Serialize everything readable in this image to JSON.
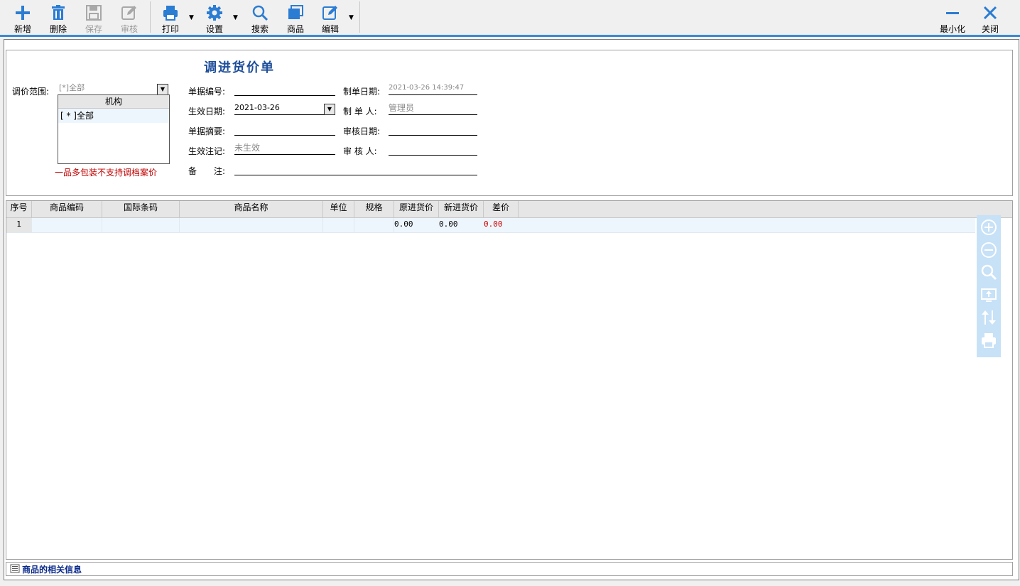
{
  "toolbar": {
    "buttons": [
      {
        "label": "新增",
        "icon": "plus-icon",
        "enabled": true
      },
      {
        "label": "删除",
        "icon": "trash-icon",
        "enabled": true
      },
      {
        "label": "保存",
        "icon": "floppy-icon",
        "enabled": false
      },
      {
        "label": "审核",
        "icon": "review-edit-icon",
        "enabled": false
      },
      {
        "label": "打印",
        "icon": "printer-icon",
        "enabled": true
      },
      {
        "label": "设置",
        "icon": "gear-icon",
        "enabled": true
      },
      {
        "label": "搜索",
        "icon": "search-icon",
        "enabled": true
      },
      {
        "label": "商品",
        "icon": "product-stack-icon",
        "enabled": true
      },
      {
        "label": "编辑",
        "icon": "edit-icon",
        "enabled": true
      }
    ],
    "minimize_label": "最小化",
    "close_label": "关闭",
    "accent_color": "#3a8ad6"
  },
  "form": {
    "title": "调进货价单",
    "scope_label": "调价范围:",
    "scope_value": "[*]全部",
    "scope_list_header": "机构",
    "scope_list_item": "[ * ]全部",
    "warning": "一品多包装不支持调档案价",
    "doc_no_label": "单据编号:",
    "doc_no_value": "",
    "effective_date_label": "生效日期:",
    "effective_date_value": "2021-03-26",
    "summary_label": "单据摘要:",
    "summary_value": "",
    "effective_flag_label": "生效注记:",
    "effective_flag_value": "未生效",
    "remark_label": "备　　注:",
    "remark_value": "",
    "created_date_label": "制单日期:",
    "created_date_value": "2021-03-26 14:39:47",
    "creator_label": "制 单 人:",
    "creator_value": "管理员",
    "audit_date_label": "审核日期:",
    "audit_date_value": "",
    "auditor_label": "审 核 人:",
    "auditor_value": ""
  },
  "grid": {
    "columns": [
      "序号",
      "商品编码",
      "国际条码",
      "商品名称",
      "单位",
      "规格",
      "原进货价",
      "新进货价",
      "差价"
    ],
    "rows": [
      {
        "seq": "1",
        "code": "",
        "barcode": "",
        "name": "",
        "unit": "",
        "spec": "",
        "old_price": "0.00",
        "new_price": "0.00",
        "diff": "0.00"
      }
    ],
    "diff_color": "#d00000"
  },
  "side_tools": [
    "zoom-in-icon",
    "zoom-out-icon",
    "magnifier-icon",
    "export-screen-icon",
    "sort-updown-icon",
    "print-icon"
  ],
  "info_bar": {
    "label": "商品的相关信息"
  }
}
